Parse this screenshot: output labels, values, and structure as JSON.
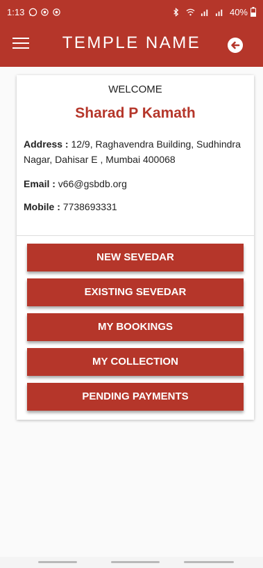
{
  "status_bar": {
    "time": "1:13",
    "battery": "40%"
  },
  "app_bar": {
    "title": "TEMPLE NAME"
  },
  "profile": {
    "welcome": "WELCOME",
    "name": "Sharad P Kamath",
    "address_label": "Address :",
    "address_value": "12/9, Raghavendra Building, Sudhindra Nagar, Dahisar E , Mumbai 400068",
    "email_label": "Email :",
    "email_value": "v66@gsbdb.org",
    "mobile_label": "Mobile :",
    "mobile_value": "7738693331"
  },
  "actions": [
    {
      "label": "NEW SEVEDAR"
    },
    {
      "label": "EXISTING SEVEDAR"
    },
    {
      "label": "MY BOOKINGS"
    },
    {
      "label": "MY COLLECTION"
    },
    {
      "label": "PENDING PAYMENTS"
    }
  ],
  "colors": {
    "primary": "#b5362a",
    "background": "#fafafa"
  },
  "icons": [
    "whatsapp-icon",
    "notification-icon",
    "bluetooth-icon",
    "wifi-icon",
    "signal-icon",
    "battery-icon",
    "menu-icon",
    "back-arrow-icon"
  ]
}
